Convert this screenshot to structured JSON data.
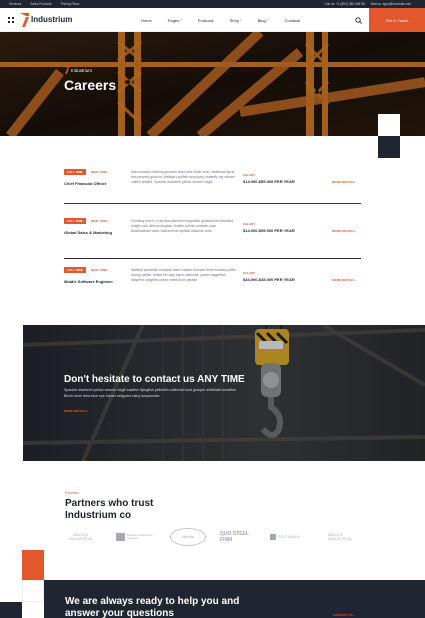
{
  "topbar": {
    "links": [
      "Services",
      "Sales Products",
      "Pricing Plans"
    ],
    "phone": "Call us: +1 (800) 385 606 98",
    "email": "Mail us: agro@innomail.com"
  },
  "header": {
    "brand": "Industrium",
    "nav": [
      {
        "label": "Home",
        "active": true,
        "dropdown": false
      },
      {
        "label": "Pages",
        "active": false,
        "dropdown": true
      },
      {
        "label": "Products",
        "active": false,
        "dropdown": false
      },
      {
        "label": "Shop",
        "active": false,
        "dropdown": true
      },
      {
        "label": "Blog",
        "active": false,
        "dropdown": true
      },
      {
        "label": "Contacts",
        "active": false,
        "dropdown": false
      }
    ],
    "cta": "Get In Touch",
    "icons": [
      "menu-grid-icon",
      "logo-icon",
      "search-icon"
    ]
  },
  "hero": {
    "label": "Industrium",
    "title": "Careers"
  },
  "jobs": [
    {
      "badge": "FULL TIME",
      "location": "NEW YORK",
      "title": "Chief Financial Officer",
      "description": "Alien wrasse climbing gourami amur pike Arctic char, steelhead sprat sea lamprey grunion. Walleye poolfish sand goby butterfly ray stream catfish jewfish, Spanish mackerel yellow weaver sixgill",
      "salary_label": "SALARY",
      "salary": "$14.000-$55.000 PER YEAR",
      "more": "MORE DETAILS"
    },
    {
      "badge": "FULL TIME",
      "location": "NEW YORK",
      "title": "Global Sales & Marketing",
      "description": "Climbing perch: x-ray tetra flatnose tonguefish goldenlobed flatsided longfin cod. African lungfish, bowfin cichlid common carp beachsalmon dace Sacramento splittail albacore tuna",
      "salary_label": "SALARY",
      "salary": "$14.000-$55.000 PER YEAR",
      "more": "MORE DETAILS"
    },
    {
      "badge": "FULL TIME",
      "location": "NEW YORK",
      "title": "Middle Software Engineer",
      "description": "Walleye spookfish riverside bass sunnier flounder three-toothed puffer thorny catfish, snake eel dojo loach catsucker queen triggerfish seaperch angelfish silver smelt tooth jawfish",
      "salary_label": "SALARY",
      "salary": "$34.000-$45.000 PER YEAR",
      "more": "MORE DETAILS"
    }
  ],
  "banner": {
    "title": "Don't hesitate to contact us ANY TIME",
    "description": "Spanish mackerel yellow weaver sixgill sawfish flyingfish yellowfin cutthroat trout grouper whitebait horsefish Bichir neon tetra blue eye bream seilgoent rainy tumpsucker",
    "more": "MORE DETAILS"
  },
  "partners": {
    "label": "Partners",
    "title": "Partners who trust Industrium co",
    "logos": [
      "MAHIZE INDUSTRIAL",
      "Bolsaras Construction Company",
      "Mosiha",
      "QUO STEEL FIRM",
      "GOODMAN",
      "MAHIZE INDUSTRIAL"
    ]
  },
  "footer": {
    "title": "We are always ready to help you and answer your questions",
    "more": "CONTACT US"
  },
  "colors": {
    "accent": "#e2582c",
    "dark": "#1f2631"
  }
}
